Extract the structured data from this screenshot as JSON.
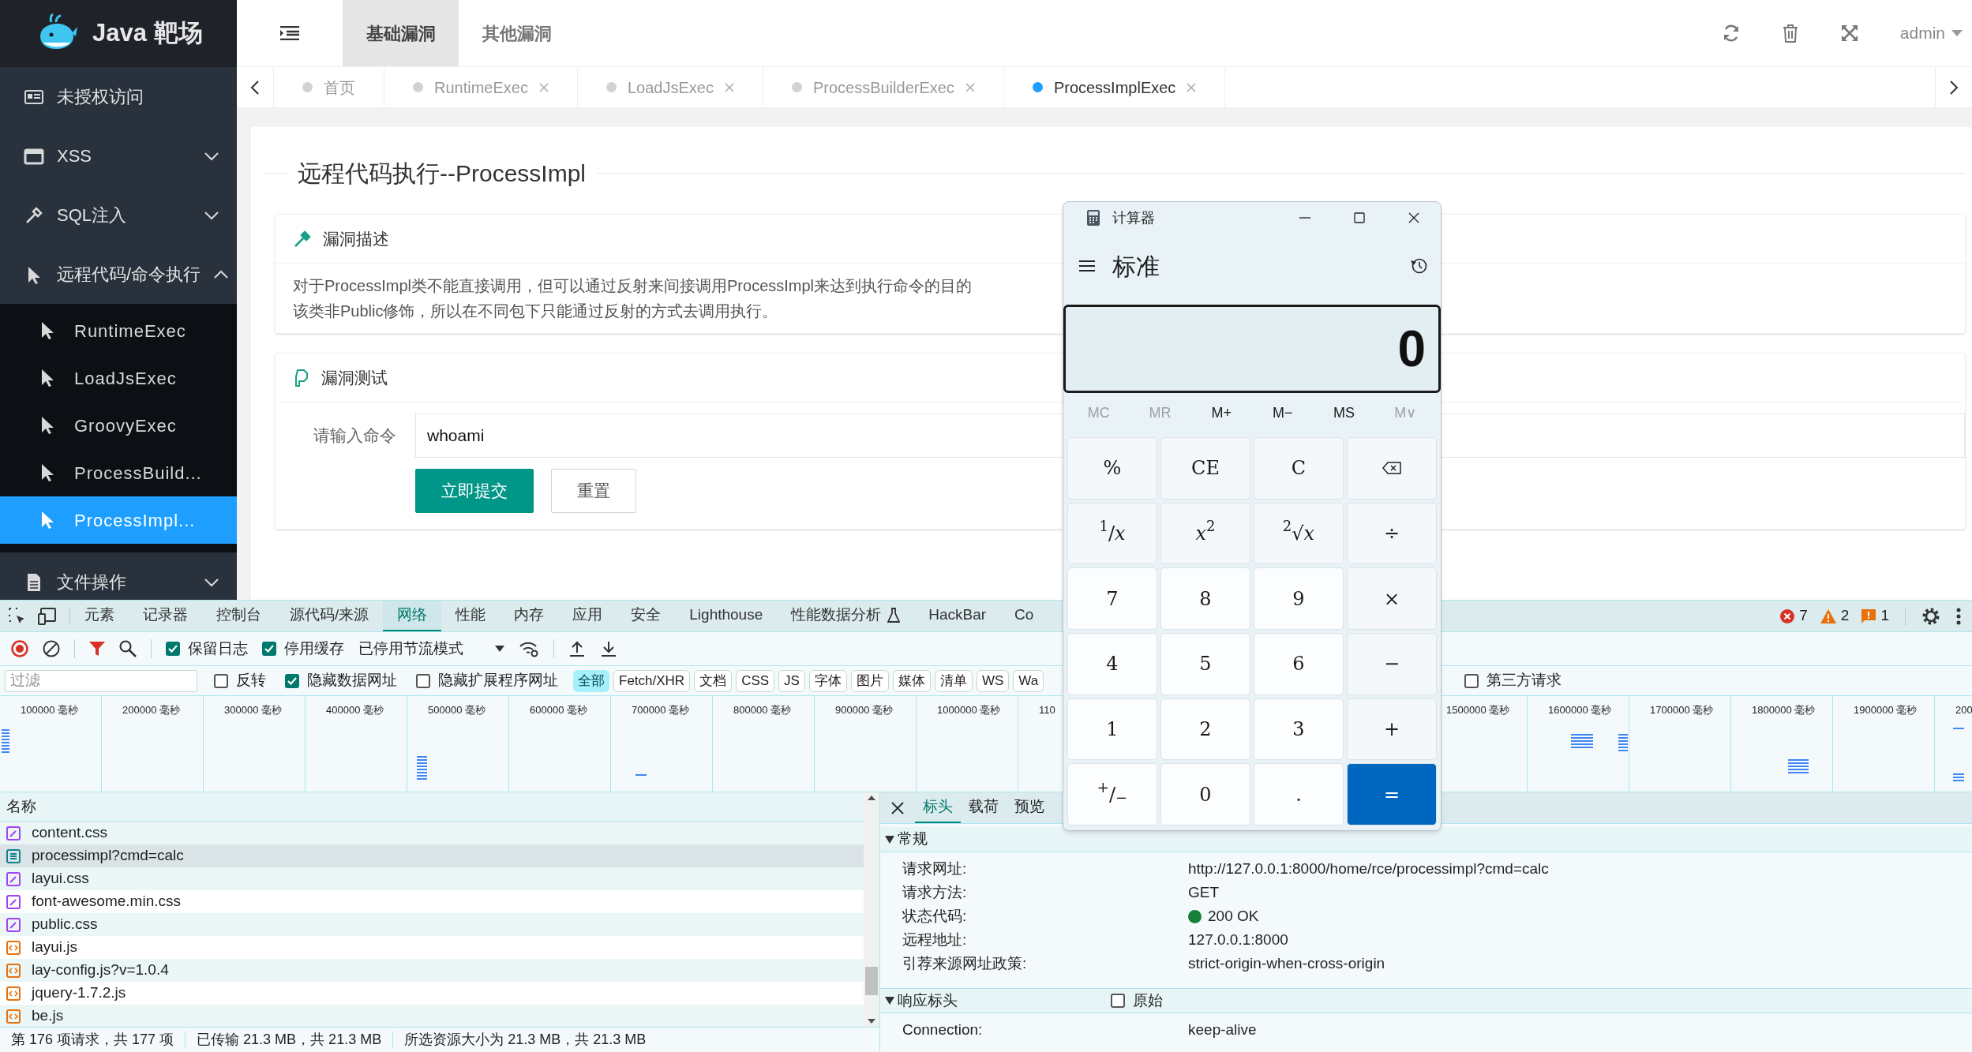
{
  "sidebar": {
    "logo": "Java 靶场",
    "items": [
      {
        "label": "未授权访问",
        "kind": "link"
      },
      {
        "label": "XSS",
        "kind": "group",
        "expanded": false
      },
      {
        "label": "SQL注入",
        "kind": "group",
        "expanded": false
      },
      {
        "label": "远程代码/命令执行",
        "kind": "group",
        "expanded": true,
        "children": [
          {
            "label": "RuntimeExec",
            "selected": false
          },
          {
            "label": "LoadJsExec",
            "selected": false
          },
          {
            "label": "GroovyExec",
            "selected": false
          },
          {
            "label": "ProcessBuild...",
            "selected": false
          },
          {
            "label": "ProcessImpl...",
            "selected": true
          }
        ]
      },
      {
        "label": "文件操作",
        "kind": "group",
        "expanded": false
      }
    ]
  },
  "header": {
    "nav_tabs": [
      {
        "label": "基础漏洞",
        "selected": true
      },
      {
        "label": "其他漏洞",
        "selected": false
      }
    ],
    "user": "admin"
  },
  "page_tabs": [
    {
      "label": "首页",
      "selected": false,
      "closable": false
    },
    {
      "label": "RuntimeExec",
      "selected": false,
      "closable": true
    },
    {
      "label": "LoadJsExec",
      "selected": false,
      "closable": true
    },
    {
      "label": "ProcessBuilderExec",
      "selected": false,
      "closable": true
    },
    {
      "label": "ProcessImplExec",
      "selected": true,
      "closable": true
    }
  ],
  "content": {
    "title": "远程代码执行--ProcessImpl",
    "sections": [
      {
        "title": "漏洞描述",
        "kind": "text",
        "lines": [
          "对于ProcessImpl类不能直接调用，但可以通过反射来间接调用ProcessImpl来达到执行命令的目的",
          "该类非Public修饰，所以在不同包下只能通过反射的方式去调用执行。"
        ]
      },
      {
        "title": "漏洞测试",
        "kind": "form",
        "field_label": "请输入命令",
        "value": "whoami",
        "buttons": [
          {
            "label": "立即提交",
            "kind": "primary"
          },
          {
            "label": "重置",
            "kind": "secondary"
          }
        ]
      }
    ]
  },
  "devtools": {
    "tabs": [
      {
        "label": "元素",
        "selected": false
      },
      {
        "label": "记录器",
        "selected": false
      },
      {
        "label": "控制台",
        "selected": false
      },
      {
        "label": "源代码/来源",
        "selected": false
      },
      {
        "label": "网络",
        "selected": true
      },
      {
        "label": "性能",
        "selected": false
      },
      {
        "label": "内存",
        "selected": false
      },
      {
        "label": "应用",
        "selected": false
      },
      {
        "label": "安全",
        "selected": false
      },
      {
        "label": "Lighthouse",
        "selected": false
      },
      {
        "label": "性能数据分析",
        "selected": false,
        "kind": "experimental"
      },
      {
        "label": "HackBar",
        "selected": false
      },
      {
        "label": "Co",
        "selected": false
      }
    ],
    "issues": {
      "errors": "7",
      "warnings": "2",
      "info": "1"
    },
    "toolbar": {
      "options": [
        {
          "label": "保留日志",
          "checked": true
        },
        {
          "label": "停用缓存",
          "checked": true
        }
      ],
      "throttling": "已停用节流模式"
    },
    "filter": {
      "placeholder": "过滤",
      "options": [
        {
          "label": "反转",
          "checked": false
        },
        {
          "label": "隐藏数据网址",
          "checked": true
        },
        {
          "label": "隐藏扩展程序网址",
          "checked": false
        }
      ],
      "types": [
        {
          "label": "全部",
          "selected": true
        },
        {
          "label": "Fetch/XHR",
          "selected": false
        },
        {
          "label": "文档",
          "selected": false
        },
        {
          "label": "CSS",
          "selected": false
        },
        {
          "label": "JS",
          "selected": false
        },
        {
          "label": "字体",
          "selected": false
        },
        {
          "label": "图片",
          "selected": false
        },
        {
          "label": "媒体",
          "selected": false
        },
        {
          "label": "清单",
          "selected": false
        },
        {
          "label": "WS",
          "selected": false
        },
        {
          "label": "Wa",
          "selected": false
        }
      ],
      "third_party": {
        "label": "第三方请求",
        "checked": false
      }
    },
    "timeline": {
      "columns": [
        {
          "label": "100000 毫秒"
        },
        {
          "label": "200000 毫秒"
        },
        {
          "label": "300000 毫秒"
        },
        {
          "label": "400000 毫秒"
        },
        {
          "label": "500000 毫秒"
        },
        {
          "label": "600000 毫秒"
        },
        {
          "label": "700000 毫秒"
        },
        {
          "label": "800000 毫秒"
        },
        {
          "label": "900000 毫秒"
        },
        {
          "label": "1000000 毫秒"
        },
        {
          "label": "110"
        },
        {},
        {},
        {},
        {
          "label": "1500000 毫秒"
        },
        {
          "label": "1600000 毫秒"
        },
        {
          "label": "1700000 毫秒"
        },
        {
          "label": "1800000 毫秒"
        },
        {
          "label": "1900000 毫秒"
        },
        {
          "label": "200"
        }
      ]
    },
    "requests": {
      "header": "名称",
      "rows": [
        {
          "name": "content.css",
          "kind": "css",
          "selected": false
        },
        {
          "name": "processimpl?cmd=calc",
          "kind": "document",
          "selected": true
        },
        {
          "name": "layui.css",
          "kind": "css",
          "selected": false
        },
        {
          "name": "font-awesome.min.css",
          "kind": "css",
          "selected": false
        },
        {
          "name": "public.css",
          "kind": "css",
          "selected": false
        },
        {
          "name": "layui.js",
          "kind": "script",
          "selected": false
        },
        {
          "name": "lay-config.js?v=1.0.4",
          "kind": "script",
          "selected": false
        },
        {
          "name": "jquery-1.7.2.js",
          "kind": "script",
          "selected": false
        },
        {
          "name": "be.js",
          "kind": "script",
          "selected": false
        }
      ]
    },
    "details": {
      "tabs": [
        {
          "label": "标头",
          "selected": true
        },
        {
          "label": "载荷",
          "selected": false
        },
        {
          "label": "预览",
          "selected": false
        }
      ],
      "general": {
        "title": "常规",
        "expanded": true,
        "rows": [
          {
            "label": "请求网址:",
            "value": "http://127.0.0.1:8000/home/rce/processimpl?cmd=calc",
            "kind": "plain"
          },
          {
            "label": "请求方法:",
            "value": "GET",
            "kind": "plain"
          },
          {
            "label": "状态代码:",
            "value": "200 OK",
            "kind": "status"
          },
          {
            "label": "远程地址:",
            "value": "127.0.0.1:8000",
            "kind": "plain"
          },
          {
            "label": "引荐来源网址政策:",
            "value": "strict-origin-when-cross-origin",
            "kind": "plain"
          }
        ]
      },
      "response_headers": {
        "title": "响应标头",
        "expanded": true,
        "raw": {
          "label": "原始",
          "checked": false
        },
        "rows": [
          {
            "label": "Connection:",
            "value": "keep-alive",
            "kind": "plain"
          }
        ]
      }
    },
    "status_bar": [
      "第 176 项请求，共 177 项",
      "已传输 21.3 MB，共 21.3 MB",
      "所选资源大小为 21.3 MB，共 21.3 MB"
    ]
  },
  "calculator": {
    "title": "计算器",
    "mode": "标准",
    "display": "0",
    "memory": [
      {
        "label": "MC",
        "disabled": true
      },
      {
        "label": "MR",
        "disabled": true
      },
      {
        "label": "M+",
        "disabled": false
      },
      {
        "label": "M−",
        "disabled": false
      },
      {
        "label": "MS",
        "disabled": false
      },
      {
        "label": "M∨",
        "disabled": true
      }
    ],
    "keys": [
      {
        "label": "%",
        "kind": "function"
      },
      {
        "label": "CE",
        "kind": "function"
      },
      {
        "label": "C",
        "kind": "function"
      },
      {
        "kind": "backspace"
      },
      {
        "label": "$^{1}$/*x*",
        "kind": "function"
      },
      {
        "label": "*x*$^{2}$",
        "kind": "function"
      },
      {
        "label": "$^{2}$√*x*",
        "kind": "function"
      },
      {
        "label": "÷",
        "kind": "function"
      },
      {
        "label": "7",
        "kind": "digit"
      },
      {
        "label": "8",
        "kind": "digit"
      },
      {
        "label": "9",
        "kind": "digit"
      },
      {
        "label": "×",
        "kind": "function"
      },
      {
        "label": "4",
        "kind": "digit"
      },
      {
        "label": "5",
        "kind": "digit"
      },
      {
        "label": "6",
        "kind": "digit"
      },
      {
        "label": "−",
        "kind": "function"
      },
      {
        "label": "1",
        "kind": "digit"
      },
      {
        "label": "2",
        "kind": "digit"
      },
      {
        "label": "3",
        "kind": "digit"
      },
      {
        "label": "+",
        "kind": "function"
      },
      {
        "label": "$^{+}$/$_{−}$",
        "kind": "digit"
      },
      {
        "label": "0",
        "kind": "digit"
      },
      {
        "label": ".",
        "kind": "digit"
      },
      {
        "label": "=",
        "kind": "equals"
      }
    ]
  }
}
